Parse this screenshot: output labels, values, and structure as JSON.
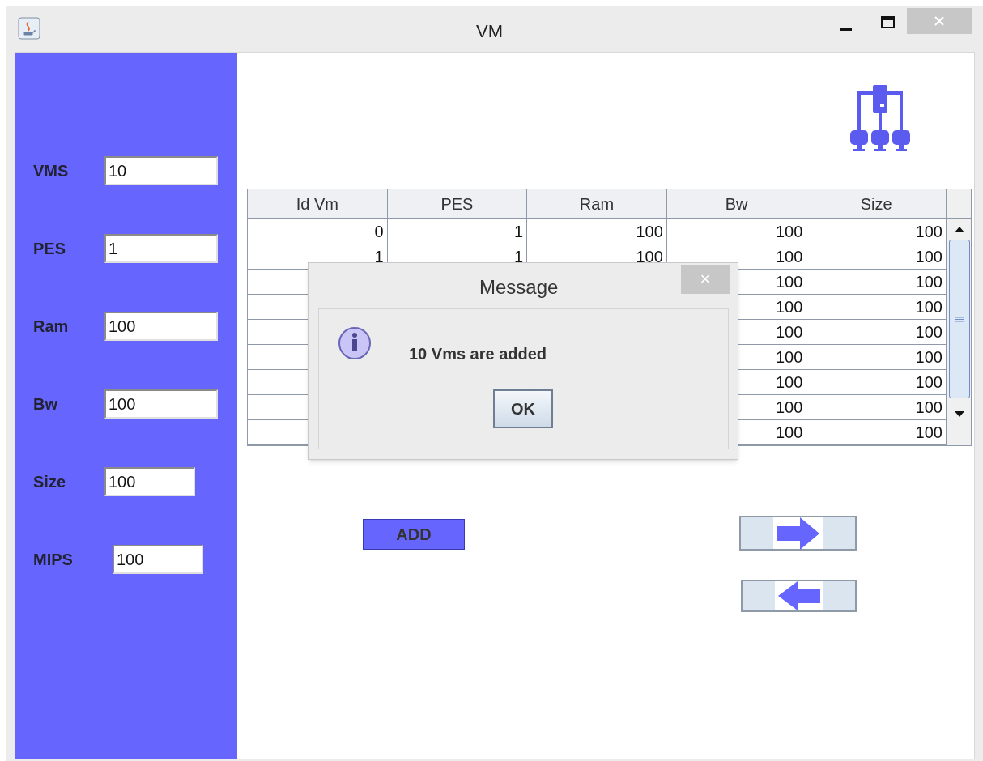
{
  "window": {
    "title": "VM"
  },
  "form": [
    {
      "label": "VMS",
      "value": "10"
    },
    {
      "label": "PES",
      "value": "1"
    },
    {
      "label": "Ram",
      "value": "100"
    },
    {
      "label": "Bw",
      "value": "100"
    },
    {
      "label": "Size",
      "value": "100"
    },
    {
      "label": "MIPS",
      "value": "100"
    }
  ],
  "table": {
    "columns": [
      "Id Vm",
      "PES",
      "Ram",
      "Bw",
      "Size"
    ],
    "rows": [
      {
        "id": "0",
        "pes": "1",
        "ram": "100",
        "bw": "100",
        "size": "100"
      },
      {
        "id": "1",
        "pes": "1",
        "ram": "100",
        "bw": "100",
        "size": "100"
      },
      {
        "bw": "100",
        "size": "100"
      },
      {
        "bw": "100",
        "size": "100"
      },
      {
        "bw": "100",
        "size": "100"
      },
      {
        "bw": "100",
        "size": "100"
      },
      {
        "bw": "100",
        "size": "100"
      },
      {
        "bw": "100",
        "size": "100"
      },
      {
        "bw": "100",
        "size": "100"
      }
    ]
  },
  "add_button": "ADD",
  "dialog": {
    "title": "Message",
    "close": "×",
    "message": "10 Vms are added",
    "button": "OK"
  }
}
